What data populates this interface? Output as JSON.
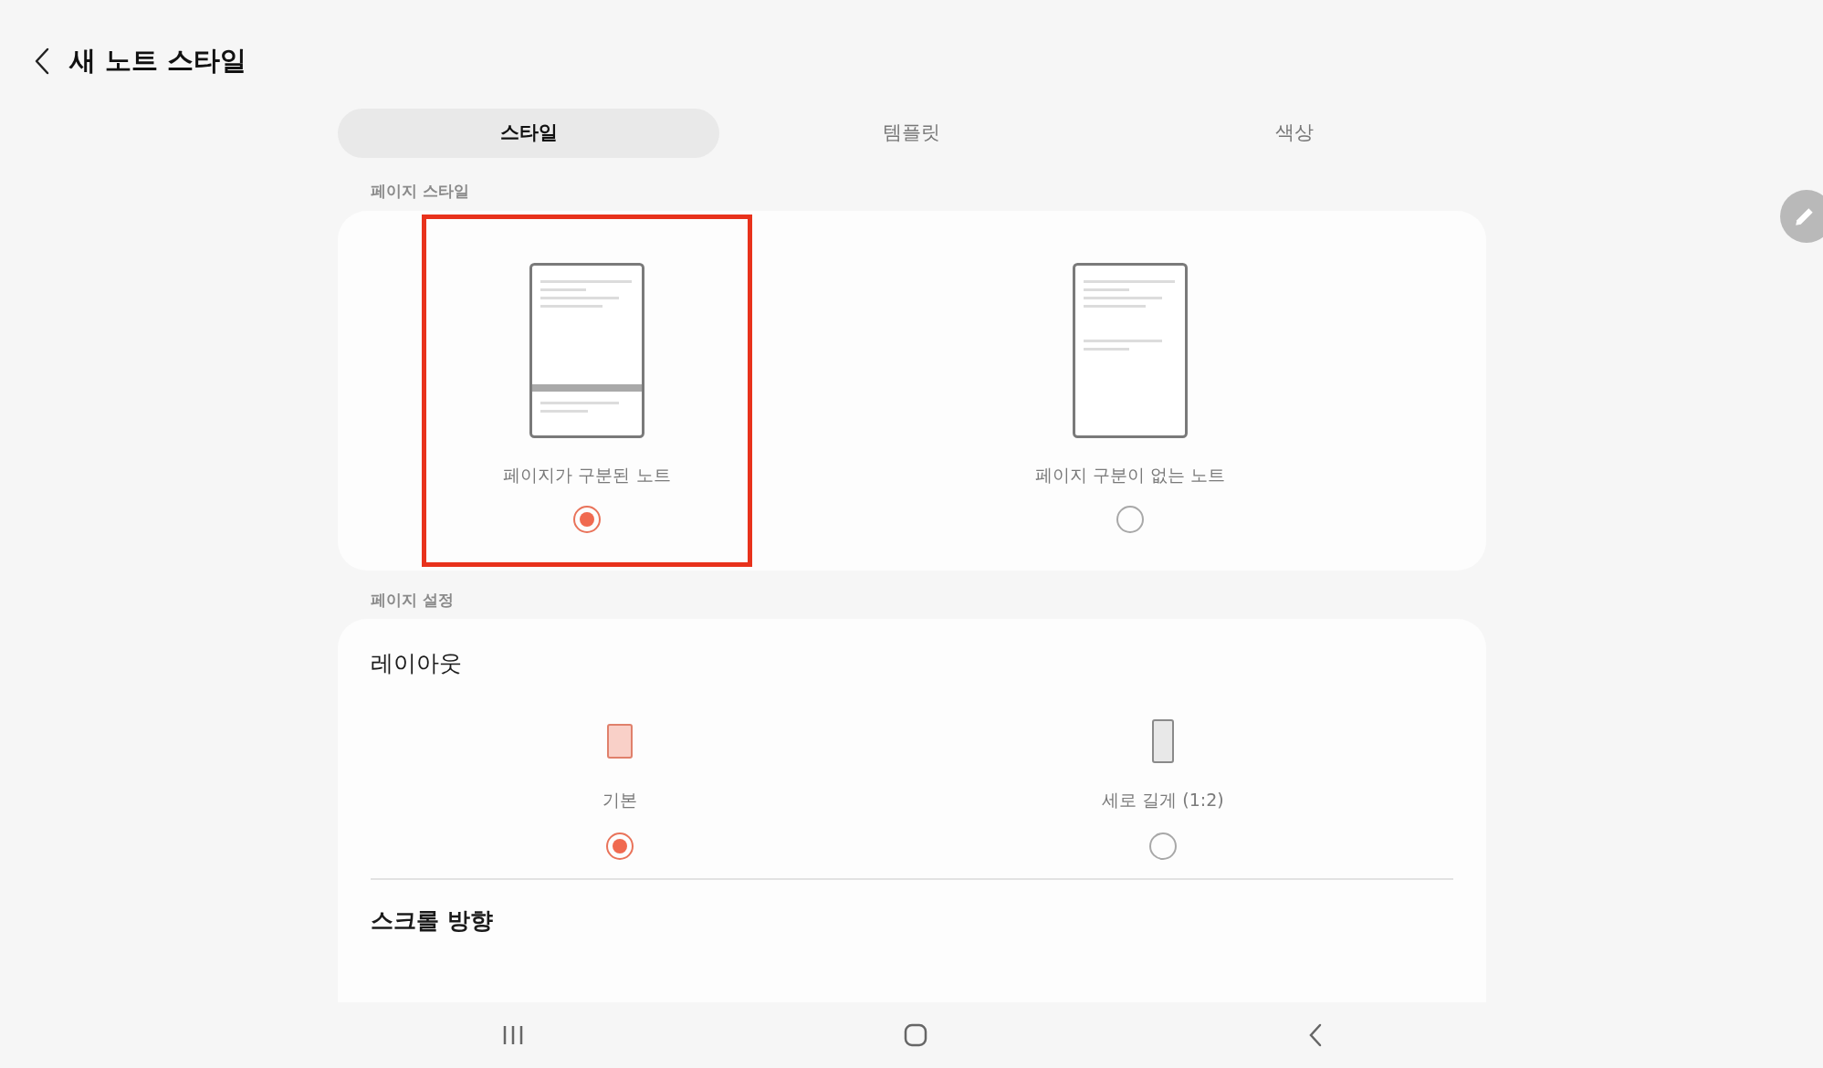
{
  "header": {
    "title": "새 노트 스타일"
  },
  "tabs": [
    {
      "label": "스타일",
      "selected": true
    },
    {
      "label": "템플릿",
      "selected": false
    },
    {
      "label": "색상",
      "selected": false
    }
  ],
  "page_style": {
    "heading": "페이지 스타일",
    "options": [
      {
        "kind": "divided",
        "label": "페이지가 구분된 노트",
        "selected": true,
        "highlighted": true
      },
      {
        "kind": "continuous",
        "label": "페이지 구분이 없는 노트",
        "selected": false,
        "highlighted": false
      }
    ]
  },
  "page_settings": {
    "heading": "페이지 설정",
    "layout": {
      "title": "레이아웃",
      "options": [
        {
          "kind": "standard",
          "label": "기본",
          "selected": true
        },
        {
          "kind": "tall",
          "label": "세로 길게 (1:2)",
          "selected": false
        }
      ]
    },
    "next_item": "스크롤 방향"
  }
}
